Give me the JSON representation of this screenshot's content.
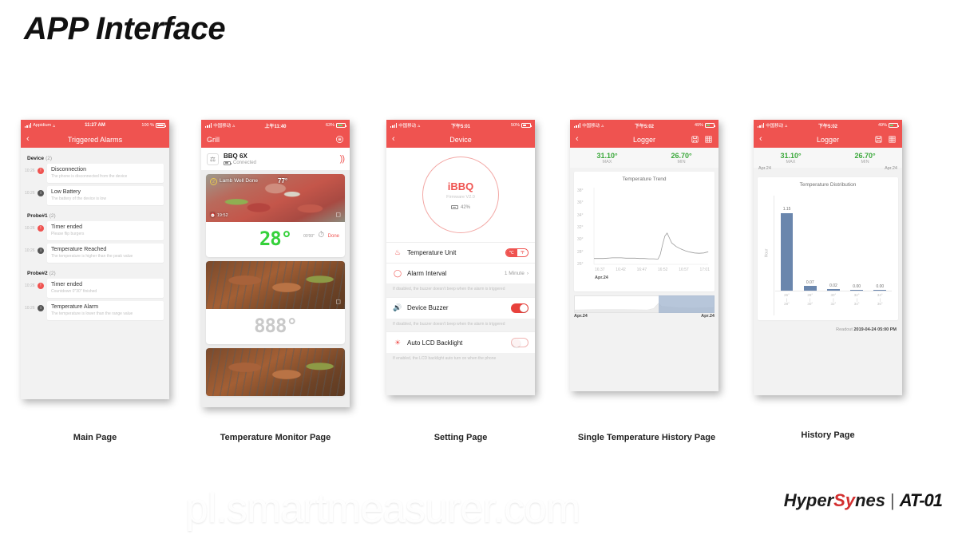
{
  "slide": {
    "title": "APP Interface",
    "watermark": "pl.smartmeasurer.com",
    "logo": {
      "brand_prefix": "Hyper",
      "brand_accent": "Sy",
      "brand_suffix": "nes",
      "divider": "|",
      "model": "AT-01"
    }
  },
  "captions": {
    "p1": "Main Page",
    "p2": "Temperature Monitor Page",
    "p3": "Setting Page",
    "p4": "Single Temperature History Page",
    "p5": "History Page"
  },
  "phone1": {
    "status": {
      "carrier": "Appidium",
      "time": "11:27 AM",
      "battery": "100 %"
    },
    "nav": {
      "title": "Triggered Alarms",
      "back_icon": "chevron-left-icon",
      "trash_icon": "trash-icon"
    },
    "groups": [
      {
        "name": "Device",
        "count": "(2)",
        "items": [
          {
            "time": "10:26",
            "dot": "red",
            "glyph": "!",
            "title": "Disconnection",
            "subtitle": "The phone is disconnected from the device"
          },
          {
            "time": "10:26",
            "dot": "grey",
            "glyph": "i",
            "title": "Low Battery",
            "subtitle": "The battery of the device is low"
          }
        ]
      },
      {
        "name": "Probe#1",
        "count": "(2)",
        "items": [
          {
            "time": "10:26",
            "dot": "red",
            "glyph": "!",
            "title": "Timer ended",
            "subtitle": "Please flip burgers"
          },
          {
            "time": "10:26",
            "dot": "grey",
            "glyph": "i",
            "title": "Temperature Reached",
            "subtitle": "The temperature is higher than the peak value"
          }
        ]
      },
      {
        "name": "Probe#2",
        "count": "(2)",
        "items": [
          {
            "time": "10:26",
            "dot": "red",
            "glyph": "!",
            "title": "Timer ended",
            "subtitle": "Countdown 0\"30\" finished"
          },
          {
            "time": "10:26",
            "dot": "grey",
            "glyph": "i",
            "title": "Temperature Alarm",
            "subtitle": "The temperature is lower than the range value"
          }
        ]
      }
    ]
  },
  "phone2": {
    "status": {
      "carrier": "中国移动",
      "time": "上午11:40",
      "battery": "63%"
    },
    "nav": {
      "title": "Grill",
      "menu_icon": "list-menu-icon"
    },
    "device": {
      "name": "BBQ 6X",
      "state": "Connected",
      "probe_icon": "probe-icon",
      "signal_icon": "wireless-signal-icon"
    },
    "probes": [
      {
        "number": "2",
        "label": "Lamb Well Done",
        "target": "77°",
        "timer": "19:52",
        "reading": "28°",
        "timer_value": "00'00\"",
        "timer_state": "Done"
      },
      {
        "number": "",
        "label": "",
        "target": "",
        "timer": "",
        "reading": "888°",
        "timer_value": "",
        "timer_state": ""
      }
    ]
  },
  "phone3": {
    "status": {
      "carrier": "中国移动",
      "time": "下午5:01",
      "battery": "50%"
    },
    "nav": {
      "title": "Device",
      "back_icon": "chevron-left-icon",
      "trash_icon": "trash-icon"
    },
    "device_card": {
      "name": "iBBQ",
      "firmware": "Firmware V2.0",
      "battery": "42%"
    },
    "settings": [
      {
        "icon": "thermometer-icon",
        "label": "Temperature Unit",
        "control": "segmented",
        "options": [
          "℃",
          "℉"
        ],
        "selected": "℃"
      },
      {
        "icon": "clock-icon",
        "label": "Alarm Interval",
        "control": "value",
        "value": "1 Minute",
        "chevron": "›"
      },
      {
        "icon": "speaker-icon",
        "label": "Device Buzzer",
        "control": "switch",
        "value": "on"
      },
      {
        "icon": "brightness-icon",
        "label": "Auto LCD Backlight",
        "control": "switch",
        "value": "off"
      }
    ],
    "notes": [
      "If disabled, the buzzer doesn't beep when the alarm is triggered",
      "If disabled, the buzzer doesn't beep when the alarm is triggered",
      "If enabled, the LCD backlight auto turn on when the phone"
    ]
  },
  "phone4": {
    "status": {
      "carrier": "中国移动",
      "time": "下午5:02",
      "battery": "49%"
    },
    "nav": {
      "title": "Logger",
      "back_icon": "chevron-left-icon",
      "save_icon": "save-icon",
      "table-icon": "grid-table-icon"
    },
    "max": {
      "value": "31.10°",
      "label": "MAX"
    },
    "min": {
      "value": "26.70°",
      "label": "MIN"
    },
    "scrubber": {
      "left_label": "Apr.24",
      "right_label": "Apr.24"
    },
    "chart_data": {
      "type": "line",
      "title": "Temperature Trend",
      "xlabel": "Apr.24",
      "ylabel": "",
      "ylim": [
        26,
        38
      ],
      "yticks": [
        "38°",
        "36°",
        "34°",
        "32°",
        "30°",
        "28°",
        "26°"
      ],
      "xticks": [
        "16:37",
        "16:42",
        "16:47",
        "16:52",
        "16:57",
        "17:01"
      ],
      "x": [
        0,
        4,
        8,
        12,
        16,
        20,
        24,
        28,
        32,
        36,
        40,
        44,
        48,
        52,
        56,
        58,
        60,
        62,
        64,
        66,
        68,
        72,
        76,
        80,
        84,
        88,
        92,
        96,
        100
      ],
      "values": [
        26.95,
        26.95,
        26.95,
        27.0,
        27.05,
        27.05,
        27.05,
        27.0,
        27.0,
        27.0,
        26.95,
        26.95,
        26.9,
        26.9,
        26.85,
        27.6,
        29.2,
        30.6,
        31.1,
        30.3,
        29.5,
        28.9,
        28.5,
        28.2,
        28.0,
        27.85,
        27.8,
        27.85,
        28.05
      ],
      "grid": false,
      "legend": "none"
    }
  },
  "phone5": {
    "status": {
      "carrier": "中国移动",
      "time": "下午5:02",
      "battery": "49%"
    },
    "nav": {
      "title": "Logger",
      "back_icon": "chevron-left-icon",
      "save_icon": "save-icon",
      "table-icon": "grid-table-icon"
    },
    "max": {
      "value": "31.10°",
      "label": "MAX"
    },
    "min": {
      "value": "26.70°",
      "label": "MIN"
    },
    "top_labels": {
      "left": "Apr.24",
      "right": "Apr.24"
    },
    "readout": {
      "label": "Readout",
      "value": "2019-04-24 05:00 PM"
    },
    "chart_data": {
      "type": "bar",
      "title": "Temperature Distribution",
      "xlabel": "",
      "ylabel": "Hour",
      "categories": [
        "26°\n|\n28°",
        "28°\n|\n30°",
        "30°\n|\n32°",
        "32°\n|\n34°",
        "34°\n|\n36°"
      ],
      "bin_tops": [
        "26°",
        "28°",
        "30°",
        "32°",
        "34°"
      ],
      "bin_bottoms": [
        "28°",
        "30°",
        "32°",
        "34°",
        "36°"
      ],
      "values": [
        1.15,
        0.07,
        0.02,
        0.0,
        0.0
      ],
      "value_labels": [
        "1.15",
        "0.07",
        "0.02",
        "0.00",
        "0.00"
      ],
      "ylim": [
        0,
        1.3
      ],
      "bar_color": "#6a86ad",
      "grid": false,
      "legend": "none"
    }
  }
}
